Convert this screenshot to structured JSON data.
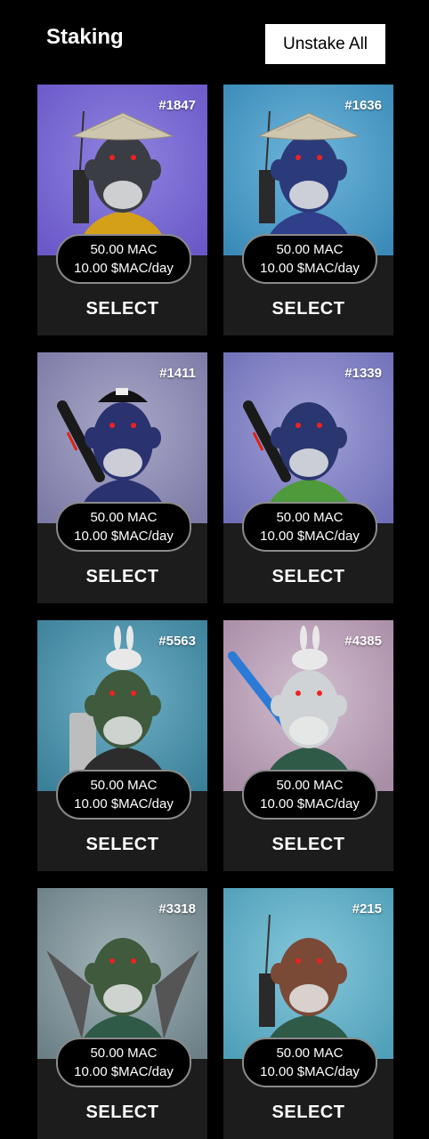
{
  "header": {
    "title": "Staking",
    "unstake_label": "Unstake All"
  },
  "cards": [
    {
      "id": "#1847",
      "amount": "50.00 MAC",
      "rate": "10.00 $MAC/day",
      "select_label": "SELECT",
      "bg": "#6a58c8",
      "bg_light": "#8f84e0",
      "head": "#3b3d44",
      "shirt": "#d4a017",
      "hat": "straw-hat",
      "accessory": "radio"
    },
    {
      "id": "#1636",
      "amount": "50.00 MAC",
      "rate": "10.00 $MAC/day",
      "select_label": "SELECT",
      "bg": "#3a8ab8",
      "bg_light": "#6fb7db",
      "head": "#2b3a7a",
      "shirt": "#2f3f8a",
      "hat": "straw-hat",
      "accessory": "radio"
    },
    {
      "id": "#1411",
      "amount": "50.00 MAC",
      "rate": "10.00 $MAC/day",
      "select_label": "SELECT",
      "bg": "#7c7aa6",
      "bg_light": "#a9a8c8",
      "head": "#2a3270",
      "shirt": "#2a3270",
      "hat": "bandana-cap",
      "accessory": "baton"
    },
    {
      "id": "#1339",
      "amount": "50.00 MAC",
      "rate": "10.00 $MAC/day",
      "select_label": "SELECT",
      "bg": "#6f6fb8",
      "bg_light": "#a2a2d8",
      "head": "#2a3670",
      "shirt": "#4f9a3a",
      "hat": "none",
      "accessory": "baton"
    },
    {
      "id": "#5563",
      "amount": "50.00 MAC",
      "rate": "10.00 $MAC/day",
      "select_label": "SELECT",
      "bg": "#3b8099",
      "bg_light": "#6fb0c6",
      "head": "#3f5a3d",
      "shirt": "#2c2c2c",
      "hat": "bunny",
      "accessory": "backpack"
    },
    {
      "id": "#4385",
      "amount": "50.00 MAC",
      "rate": "10.00 $MAC/day",
      "select_label": "SELECT",
      "bg": "#a98ca6",
      "bg_light": "#d2bfd0",
      "head": "#cfd3d6",
      "shirt": "#2f5a48",
      "hat": "bunny",
      "accessory": "gun"
    },
    {
      "id": "#3318",
      "amount": "50.00 MAC",
      "rate": "10.00 $MAC/day",
      "select_label": "SELECT",
      "bg": "#6b7f86",
      "bg_light": "#a5b6bb",
      "head": "#3f5a3d",
      "shirt": "#2f5a48",
      "hat": "none",
      "accessory": "wings"
    },
    {
      "id": "#215",
      "amount": "50.00 MAC",
      "rate": "10.00 $MAC/day",
      "select_label": "SELECT",
      "bg": "#4f9fb8",
      "bg_light": "#86c8db",
      "head": "#7a4a36",
      "shirt": "#2f5a48",
      "hat": "none",
      "accessory": "radio"
    }
  ]
}
